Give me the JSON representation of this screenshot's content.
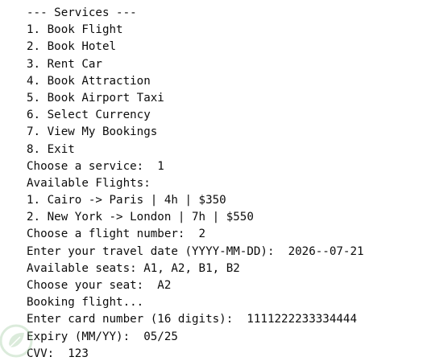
{
  "console": {
    "lines": [
      "--- Services ---",
      "1. Book Flight",
      "2. Book Hotel",
      "3. Rent Car",
      "4. Book Attraction",
      "5. Book Airport Taxi",
      "6. Select Currency",
      "7. View My Bookings",
      "8. Exit",
      "Choose a service:  1",
      "Available Flights:",
      "1. Cairo -> Paris | 4h | $350",
      "2. New York -> London | 7h | $550",
      "Choose a flight number:  2",
      "Enter your travel date (YYYY-MM-DD):  2026--07-21",
      "Available seats: A1, A2, B1, B2",
      "Choose your seat:  A2",
      "Booking flight...",
      "Enter card number (16 digits):  1111222233334444",
      "Expiry (MM/YY):  05/25",
      "CVV:  123"
    ]
  },
  "watermark": {
    "icon": "leaf-logo-icon",
    "color": "#9bc79b"
  }
}
